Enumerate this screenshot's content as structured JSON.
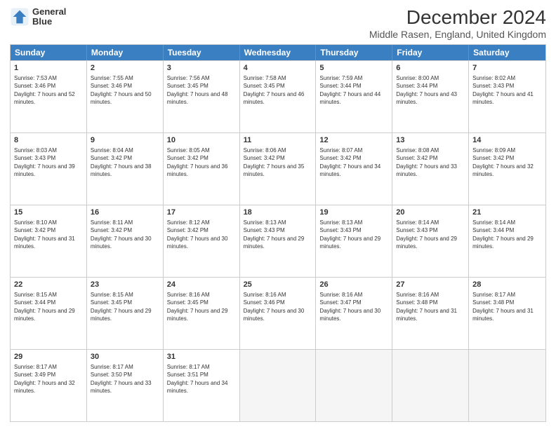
{
  "header": {
    "logo_line1": "General",
    "logo_line2": "Blue",
    "main_title": "December 2024",
    "subtitle": "Middle Rasen, England, United Kingdom"
  },
  "calendar": {
    "days": [
      "Sunday",
      "Monday",
      "Tuesday",
      "Wednesday",
      "Thursday",
      "Friday",
      "Saturday"
    ],
    "rows": [
      [
        {
          "day": "1",
          "sunrise": "Sunrise: 7:53 AM",
          "sunset": "Sunset: 3:46 PM",
          "daylight": "Daylight: 7 hours and 52 minutes."
        },
        {
          "day": "2",
          "sunrise": "Sunrise: 7:55 AM",
          "sunset": "Sunset: 3:46 PM",
          "daylight": "Daylight: 7 hours and 50 minutes."
        },
        {
          "day": "3",
          "sunrise": "Sunrise: 7:56 AM",
          "sunset": "Sunset: 3:45 PM",
          "daylight": "Daylight: 7 hours and 48 minutes."
        },
        {
          "day": "4",
          "sunrise": "Sunrise: 7:58 AM",
          "sunset": "Sunset: 3:45 PM",
          "daylight": "Daylight: 7 hours and 46 minutes."
        },
        {
          "day": "5",
          "sunrise": "Sunrise: 7:59 AM",
          "sunset": "Sunset: 3:44 PM",
          "daylight": "Daylight: 7 hours and 44 minutes."
        },
        {
          "day": "6",
          "sunrise": "Sunrise: 8:00 AM",
          "sunset": "Sunset: 3:44 PM",
          "daylight": "Daylight: 7 hours and 43 minutes."
        },
        {
          "day": "7",
          "sunrise": "Sunrise: 8:02 AM",
          "sunset": "Sunset: 3:43 PM",
          "daylight": "Daylight: 7 hours and 41 minutes."
        }
      ],
      [
        {
          "day": "8",
          "sunrise": "Sunrise: 8:03 AM",
          "sunset": "Sunset: 3:43 PM",
          "daylight": "Daylight: 7 hours and 39 minutes."
        },
        {
          "day": "9",
          "sunrise": "Sunrise: 8:04 AM",
          "sunset": "Sunset: 3:42 PM",
          "daylight": "Daylight: 7 hours and 38 minutes."
        },
        {
          "day": "10",
          "sunrise": "Sunrise: 8:05 AM",
          "sunset": "Sunset: 3:42 PM",
          "daylight": "Daylight: 7 hours and 36 minutes."
        },
        {
          "day": "11",
          "sunrise": "Sunrise: 8:06 AM",
          "sunset": "Sunset: 3:42 PM",
          "daylight": "Daylight: 7 hours and 35 minutes."
        },
        {
          "day": "12",
          "sunrise": "Sunrise: 8:07 AM",
          "sunset": "Sunset: 3:42 PM",
          "daylight": "Daylight: 7 hours and 34 minutes."
        },
        {
          "day": "13",
          "sunrise": "Sunrise: 8:08 AM",
          "sunset": "Sunset: 3:42 PM",
          "daylight": "Daylight: 7 hours and 33 minutes."
        },
        {
          "day": "14",
          "sunrise": "Sunrise: 8:09 AM",
          "sunset": "Sunset: 3:42 PM",
          "daylight": "Daylight: 7 hours and 32 minutes."
        }
      ],
      [
        {
          "day": "15",
          "sunrise": "Sunrise: 8:10 AM",
          "sunset": "Sunset: 3:42 PM",
          "daylight": "Daylight: 7 hours and 31 minutes."
        },
        {
          "day": "16",
          "sunrise": "Sunrise: 8:11 AM",
          "sunset": "Sunset: 3:42 PM",
          "daylight": "Daylight: 7 hours and 30 minutes."
        },
        {
          "day": "17",
          "sunrise": "Sunrise: 8:12 AM",
          "sunset": "Sunset: 3:42 PM",
          "daylight": "Daylight: 7 hours and 30 minutes."
        },
        {
          "day": "18",
          "sunrise": "Sunrise: 8:13 AM",
          "sunset": "Sunset: 3:43 PM",
          "daylight": "Daylight: 7 hours and 29 minutes."
        },
        {
          "day": "19",
          "sunrise": "Sunrise: 8:13 AM",
          "sunset": "Sunset: 3:43 PM",
          "daylight": "Daylight: 7 hours and 29 minutes."
        },
        {
          "day": "20",
          "sunrise": "Sunrise: 8:14 AM",
          "sunset": "Sunset: 3:43 PM",
          "daylight": "Daylight: 7 hours and 29 minutes."
        },
        {
          "day": "21",
          "sunrise": "Sunrise: 8:14 AM",
          "sunset": "Sunset: 3:44 PM",
          "daylight": "Daylight: 7 hours and 29 minutes."
        }
      ],
      [
        {
          "day": "22",
          "sunrise": "Sunrise: 8:15 AM",
          "sunset": "Sunset: 3:44 PM",
          "daylight": "Daylight: 7 hours and 29 minutes."
        },
        {
          "day": "23",
          "sunrise": "Sunrise: 8:15 AM",
          "sunset": "Sunset: 3:45 PM",
          "daylight": "Daylight: 7 hours and 29 minutes."
        },
        {
          "day": "24",
          "sunrise": "Sunrise: 8:16 AM",
          "sunset": "Sunset: 3:45 PM",
          "daylight": "Daylight: 7 hours and 29 minutes."
        },
        {
          "day": "25",
          "sunrise": "Sunrise: 8:16 AM",
          "sunset": "Sunset: 3:46 PM",
          "daylight": "Daylight: 7 hours and 30 minutes."
        },
        {
          "day": "26",
          "sunrise": "Sunrise: 8:16 AM",
          "sunset": "Sunset: 3:47 PM",
          "daylight": "Daylight: 7 hours and 30 minutes."
        },
        {
          "day": "27",
          "sunrise": "Sunrise: 8:16 AM",
          "sunset": "Sunset: 3:48 PM",
          "daylight": "Daylight: 7 hours and 31 minutes."
        },
        {
          "day": "28",
          "sunrise": "Sunrise: 8:17 AM",
          "sunset": "Sunset: 3:48 PM",
          "daylight": "Daylight: 7 hours and 31 minutes."
        }
      ],
      [
        {
          "day": "29",
          "sunrise": "Sunrise: 8:17 AM",
          "sunset": "Sunset: 3:49 PM",
          "daylight": "Daylight: 7 hours and 32 minutes."
        },
        {
          "day": "30",
          "sunrise": "Sunrise: 8:17 AM",
          "sunset": "Sunset: 3:50 PM",
          "daylight": "Daylight: 7 hours and 33 minutes."
        },
        {
          "day": "31",
          "sunrise": "Sunrise: 8:17 AM",
          "sunset": "Sunset: 3:51 PM",
          "daylight": "Daylight: 7 hours and 34 minutes."
        },
        null,
        null,
        null,
        null
      ]
    ]
  }
}
